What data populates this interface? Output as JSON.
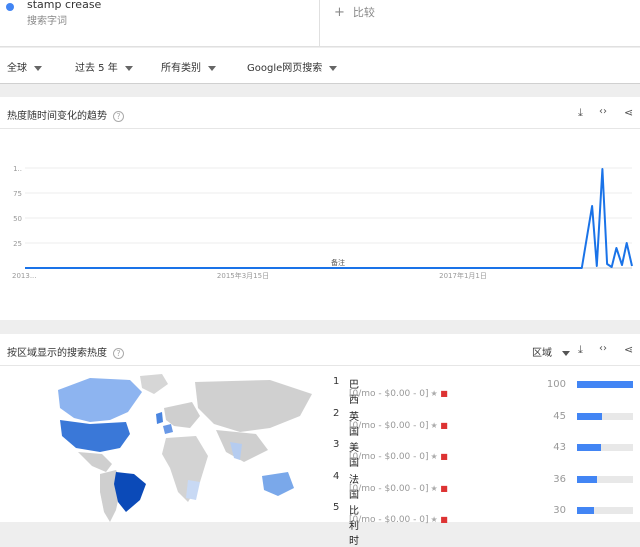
{
  "term": {
    "name": "stamp crease",
    "subtitle": "搜索字词"
  },
  "compare": {
    "plus": "+",
    "label": "比较"
  },
  "filters": [
    {
      "label": "全球"
    },
    {
      "label": "过去 5 年"
    },
    {
      "label": "所有类别"
    },
    {
      "label": "Google网页搜索"
    }
  ],
  "interest_card": {
    "title": "热度随时间变化的趋势",
    "help": "?",
    "tools": {
      "download": "⤓",
      "embed": "‹›",
      "share": "⋖"
    }
  },
  "chart_data": {
    "type": "line",
    "xlabel": "",
    "ylabel": "",
    "ylim": [
      0,
      100
    ],
    "y_ticks": [
      "1..",
      "75",
      "50",
      "25"
    ],
    "x_ticks": [
      "2013...",
      "2015年3月15日",
      "2017年1月1日"
    ],
    "annotation": "备注",
    "x_range": [
      "2013-05",
      "2018-05"
    ],
    "series": [
      {
        "color": "#1a73e8",
        "x": [
          "2013-05",
          "2014-05",
          "2015-05",
          "2016-05",
          "2017-05",
          "2017-12",
          "2018-01",
          "2018-01-15",
          "2018-02",
          "2018-02-15",
          "2018-03",
          "2018-03-15",
          "2018-04",
          "2018-04-15",
          "2018-05"
        ],
        "values": [
          0,
          0,
          0,
          0,
          0,
          0,
          62,
          2,
          99,
          4,
          1,
          20,
          3,
          25,
          2
        ]
      }
    ]
  },
  "region_card": {
    "title": "按区域显示的搜索热度",
    "help": "?",
    "select_label": "区域",
    "tools": {
      "download": "⤓",
      "embed": "‹›",
      "share": "⋖"
    },
    "detail_text": "[0/mo - $0.00 - 0]",
    "regions": [
      {
        "rank": "1",
        "name": "巴西",
        "value": "100",
        "level": 100
      },
      {
        "rank": "2",
        "name": "英国",
        "value": "45",
        "level": 45
      },
      {
        "rank": "3",
        "name": "美国",
        "value": "43",
        "level": 43
      },
      {
        "rank": "4",
        "name": "法国",
        "value": "36",
        "level": 36
      },
      {
        "rank": "5",
        "name": "比利时",
        "value": "30",
        "level": 30
      }
    ]
  }
}
